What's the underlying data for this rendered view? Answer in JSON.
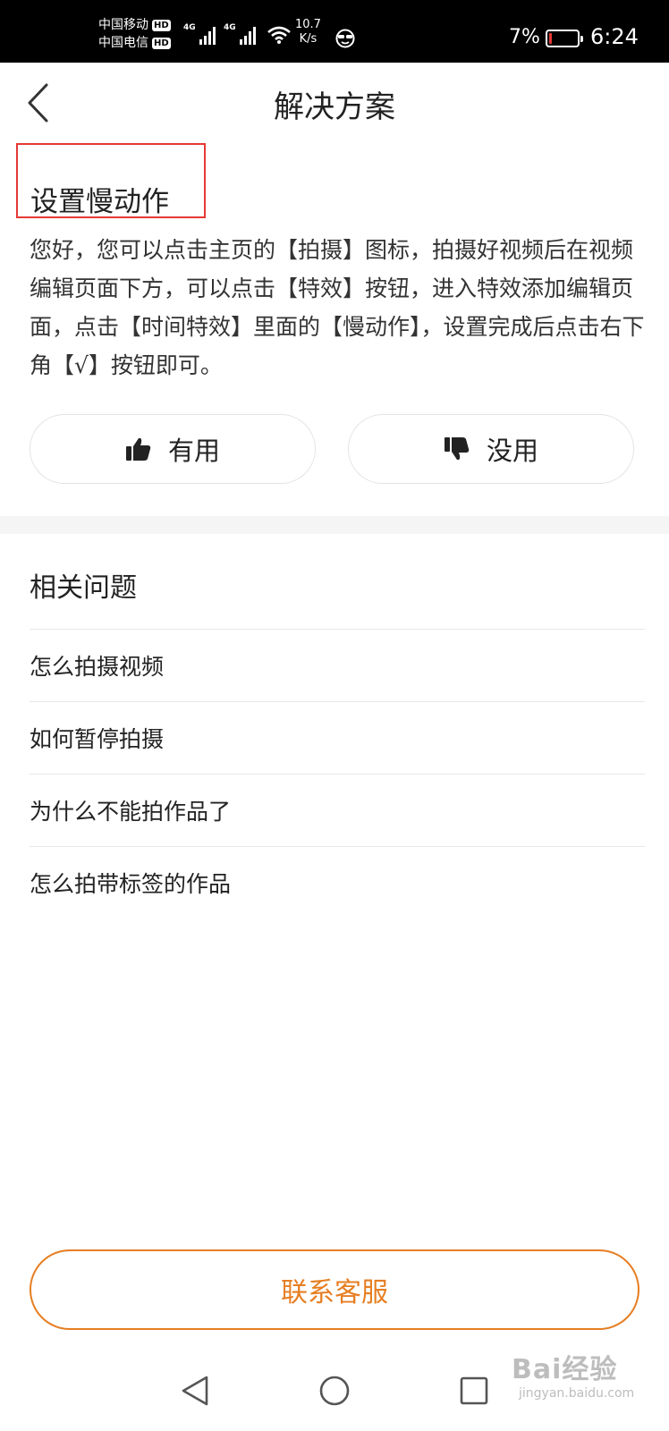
{
  "status_bar": {
    "carrier1": "中国移动",
    "carrier2": "中国电信",
    "hd_badge": "HD",
    "network": "4G",
    "speed_value": "10.7",
    "speed_unit": "K/s",
    "battery_percent": "7%",
    "battery_level": 0.07,
    "time": "6:24",
    "colors": {
      "battery_low": "#e53935"
    }
  },
  "header": {
    "back_icon": "chevron-left-icon",
    "title": "解决方案"
  },
  "solution": {
    "title": "设置慢动作",
    "body": "您好，您可以点击主页的【拍摄】图标，拍摄好视频后在视频编辑页面下方，可以点击【特效】按钮，进入特效添加编辑页面，点击【时间特效】里面的【慢动作】，设置完成后点击右下角【√】按钮即可。"
  },
  "feedback": {
    "useful_label": "有用",
    "useful_icon": "thumbs-up-icon",
    "useless_label": "没用",
    "useless_icon": "thumbs-down-icon"
  },
  "related": {
    "heading": "相关问题",
    "items": [
      "怎么拍摄视频",
      "如何暂停拍摄",
      "为什么不能拍作品了",
      "怎么拍带标签的作品"
    ]
  },
  "contact": {
    "label": "联系客服",
    "accent_color": "#e67e22"
  },
  "nav": {
    "back_icon": "triangle-back-icon",
    "home_icon": "circle-home-icon",
    "recent_icon": "square-recent-icon"
  },
  "watermark": {
    "brand": "Bai经验",
    "domain": "jingyan.baidu.com"
  }
}
